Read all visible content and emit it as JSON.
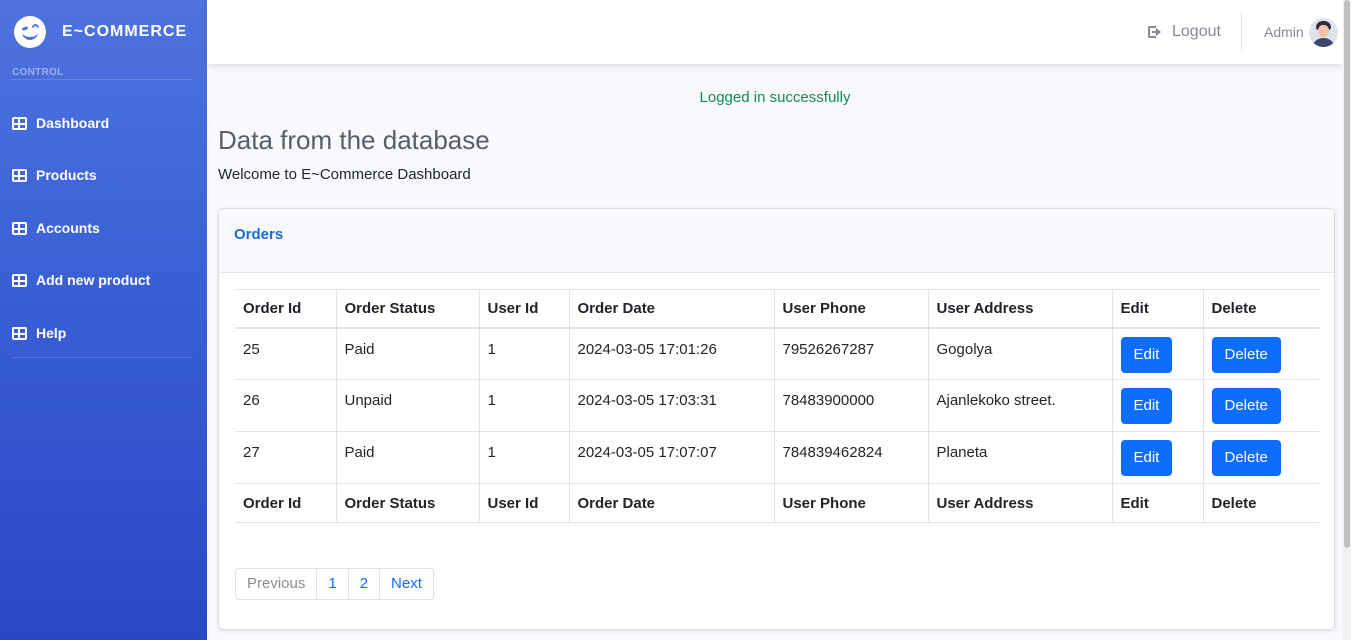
{
  "sidebar": {
    "brand": "E~COMMERCE",
    "section_label": "CONTROL",
    "items": [
      {
        "label": "Dashboard"
      },
      {
        "label": "Products"
      },
      {
        "label": "Accounts"
      },
      {
        "label": "Add new product"
      },
      {
        "label": "Help"
      }
    ]
  },
  "topbar": {
    "logout_label": "Logout",
    "user_name": "Admin"
  },
  "alert": "Logged in successfully",
  "page": {
    "title": "Data from the database",
    "subtitle": "Welcome to E~Commerce Dashboard"
  },
  "orders": {
    "card_title": "Orders",
    "columns": [
      "Order Id",
      "Order Status",
      "User Id",
      "Order Date",
      "User Phone",
      "User Address",
      "Edit",
      "Delete"
    ],
    "rows": [
      {
        "id": "25",
        "status": "Paid",
        "user_id": "1",
        "date": "2024-03-05 17:01:26",
        "phone": "79526267287",
        "address": "Gogolya",
        "edit": "Edit",
        "delete": "Delete"
      },
      {
        "id": "26",
        "status": "Unpaid",
        "user_id": "1",
        "date": "2024-03-05 17:03:31",
        "phone": "78483900000",
        "address": "Ajanlekoko street.",
        "edit": "Edit",
        "delete": "Delete"
      },
      {
        "id": "27",
        "status": "Paid",
        "user_id": "1",
        "date": "2024-03-05 17:07:07",
        "phone": "784839462824",
        "address": "Planeta",
        "edit": "Edit",
        "delete": "Delete"
      }
    ]
  },
  "pagination": {
    "previous": "Previous",
    "pages": [
      "1",
      "2"
    ],
    "next": "Next"
  },
  "colors": {
    "sidebar_top": "#4e73df",
    "sidebar_bottom": "#2948c6",
    "primary": "#0d6efd",
    "success": "#198754"
  }
}
